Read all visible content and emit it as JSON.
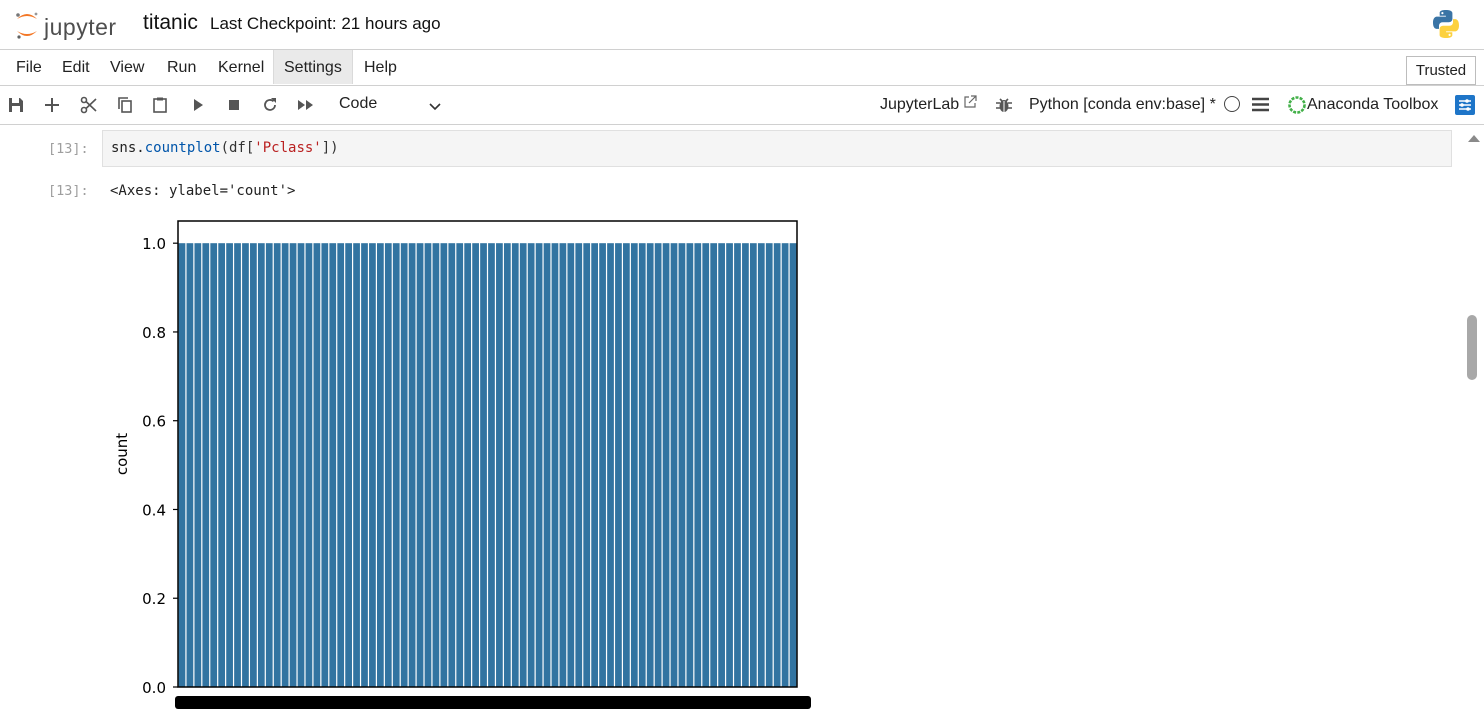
{
  "header": {
    "logo_text": "jupyter",
    "notebook_title": "titanic",
    "checkpoint": "Last Checkpoint: 21 hours ago"
  },
  "menu": {
    "items": [
      "File",
      "Edit",
      "View",
      "Run",
      "Kernel",
      "Settings",
      "Help"
    ],
    "active": "Settings",
    "trusted_label": "Trusted"
  },
  "toolbar": {
    "icons": [
      "save-icon",
      "add-cell-icon",
      "cut-icon",
      "copy-icon",
      "paste-icon",
      "run-icon",
      "stop-icon",
      "restart-icon",
      "fast-forward-icon"
    ],
    "cell_type": "Code",
    "jupyterlab_label": "JupyterLab",
    "kernel_label": "Python [conda env:base] *",
    "anaconda_label": "Anaconda Toolbox"
  },
  "cell": {
    "in_prompt": "[13]:",
    "code": {
      "prefix": "sns.",
      "fn": "countplot",
      "open": "(df[",
      "str": "'Pclass'",
      "close": "])"
    },
    "out_prompt": "[13]:",
    "output_text": "<Axes: ylabel='count'>"
  },
  "chart_data": {
    "type": "bar",
    "title": "",
    "xlabel": "",
    "ylabel": "count",
    "ylim": [
      0,
      1.05
    ],
    "yticks": [
      "0.0",
      "0.2",
      "0.4",
      "0.6",
      "0.8",
      "1.0"
    ],
    "bar_count": 78,
    "bar_value": 1.0,
    "bar_color": "#3274a1",
    "x_tick_labels": "overlapping, illegible"
  },
  "colors": {
    "accent": "#1e75c8",
    "jupyter_orange": "#f37726"
  }
}
